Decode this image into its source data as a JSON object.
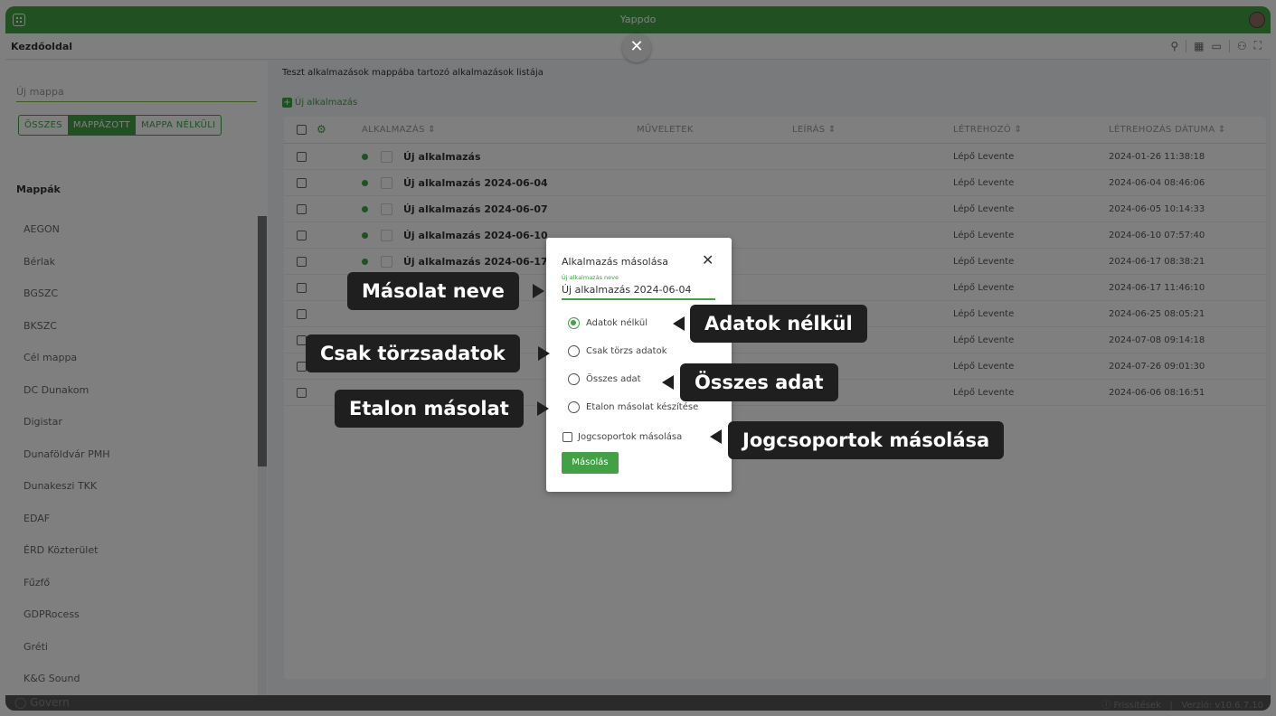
{
  "window": {
    "title": "Yappdo"
  },
  "topbar": {
    "home": "Kezdőoldal"
  },
  "sidebar": {
    "new_folder_placeholder": "Új mappa",
    "filters": [
      "ÖSSZES",
      "MAPPÁZOTT",
      "MAPPA NÉLKÜLI"
    ],
    "folders_title": "Mappák",
    "folders": [
      "AEGON",
      "Bérlak",
      "BGSZC",
      "BKSZC",
      "Cél mappa",
      "DC Dunakom",
      "Digistar",
      "Dunaföldvár PMH",
      "Dunakeszi TKK",
      "EDAF",
      "ÉRD Közterület",
      "Fűzfő",
      "GDPRocess",
      "Gréti",
      "K&G Sound"
    ]
  },
  "main": {
    "description": "Teszt alkalmazások mappába tartozó alkalmazások listája",
    "new_app": "Új alkalmazás",
    "columns": {
      "app": "ALKALMAZÁS ⇕",
      "actions": "MŰVELETEK",
      "description": "LEÍRÁS ⇕",
      "creator": "LÉTREHOZÓ ⇕",
      "date": "LÉTREHOZÁS DÁTUMA ⇕"
    },
    "rows": [
      {
        "name": "Új alkalmazás",
        "creator": "Lépő Levente",
        "date": "2024-01-26 11:38:18"
      },
      {
        "name": "Új alkalmazás 2024-06-04",
        "creator": "Lépő Levente",
        "date": "2024-06-04 08:46:06"
      },
      {
        "name": "Új alkalmazás 2024-06-07",
        "creator": "Lépő Levente",
        "date": "2024-06-05 10:14:33"
      },
      {
        "name": "Új alkalmazás 2024-06-10",
        "creator": "Lépő Levente",
        "date": "2024-06-10 07:57:40"
      },
      {
        "name": "Új alkalmazás 2024-06-17",
        "creator": "Lépő Levente",
        "date": "2024-06-17 08:38:21"
      },
      {
        "name": "",
        "creator": "Lépő Levente",
        "date": "2024-06-17 11:46:10"
      },
      {
        "name": "",
        "creator": "Lépő Levente",
        "date": "2024-06-25 08:05:21"
      },
      {
        "name": "",
        "creator": "Lépő Levente",
        "date": "2024-07-08 09:14:18"
      },
      {
        "name": "",
        "creator": "Lépő Levente",
        "date": "2024-07-26 09:01:30"
      },
      {
        "name": "",
        "creator": "Lépő Levente",
        "date": "2024-06-06 08:16:51"
      }
    ]
  },
  "footer": {
    "brand": "◯ Govern",
    "updates": "ⓘ Frissítések",
    "version": "Verzió: v10.6.7.10"
  },
  "dialog": {
    "title": "Alkalmazás másolása",
    "close": "✕",
    "field_label": "Új alkalmazás neve",
    "field_value": "Új alkalmazás 2024-06-04",
    "options": [
      "Adatok nélkül",
      "Csak törzs adatok",
      "Összes adat",
      "Etalon másolat készítése"
    ],
    "selected_option": "Adatok nélkül",
    "checkbox_label": "Jogcsoportok másolása",
    "copy_button": "Másolás"
  },
  "callouts": {
    "name": "Másolat neve",
    "no_data": "Adatok nélkül",
    "master": "Csak törzsadatok",
    "all": "Összes adat",
    "etalon": "Etalon másolat",
    "groups": "Jogcsoportok másolása"
  },
  "colors": {
    "accent": "#43a047",
    "callout_bg": "#1f1f1f"
  }
}
